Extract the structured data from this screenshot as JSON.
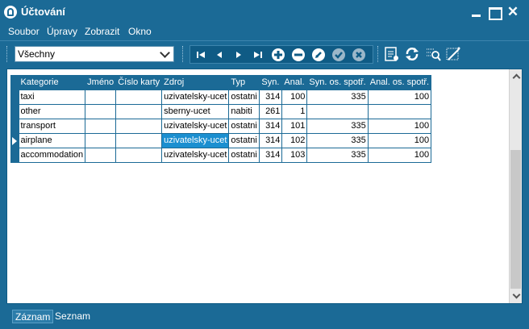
{
  "window": {
    "title": "Účtování"
  },
  "menu": [
    "Soubor",
    "Úpravy",
    "Zobrazit",
    "Okno"
  ],
  "filter": {
    "value": "Všechny"
  },
  "grid": {
    "columns": [
      "Kategorie",
      "Jméno",
      "Číslo karty",
      "Zdroj",
      "Typ",
      "Syn.",
      "Anal.",
      "Syn. os. spotř.",
      "Anal. os. spotř."
    ],
    "rows": [
      [
        "taxi",
        "",
        "",
        "uzivatelsky-ucet",
        "ostatni",
        "314",
        "100",
        "335",
        "100"
      ],
      [
        "other",
        "",
        "",
        "sberny-ucet",
        "nabiti",
        "261",
        "1",
        "",
        ""
      ],
      [
        "transport",
        "",
        "",
        "uzivatelsky-ucet",
        "ostatni",
        "314",
        "101",
        "335",
        "100"
      ],
      [
        "airplane",
        "",
        "",
        "uzivatelsky-ucet",
        "ostatni",
        "314",
        "102",
        "335",
        "100"
      ],
      [
        "accommodation",
        "",
        "",
        "uzivatelsky-ucet",
        "ostatni",
        "314",
        "103",
        "335",
        "100"
      ]
    ],
    "current_row": 3
  },
  "tabs": [
    "Záznam",
    "Seznam"
  ],
  "colors": {
    "chrome": "#1b6a96",
    "selection": "#1b8fd0",
    "client": "#ffffff"
  }
}
